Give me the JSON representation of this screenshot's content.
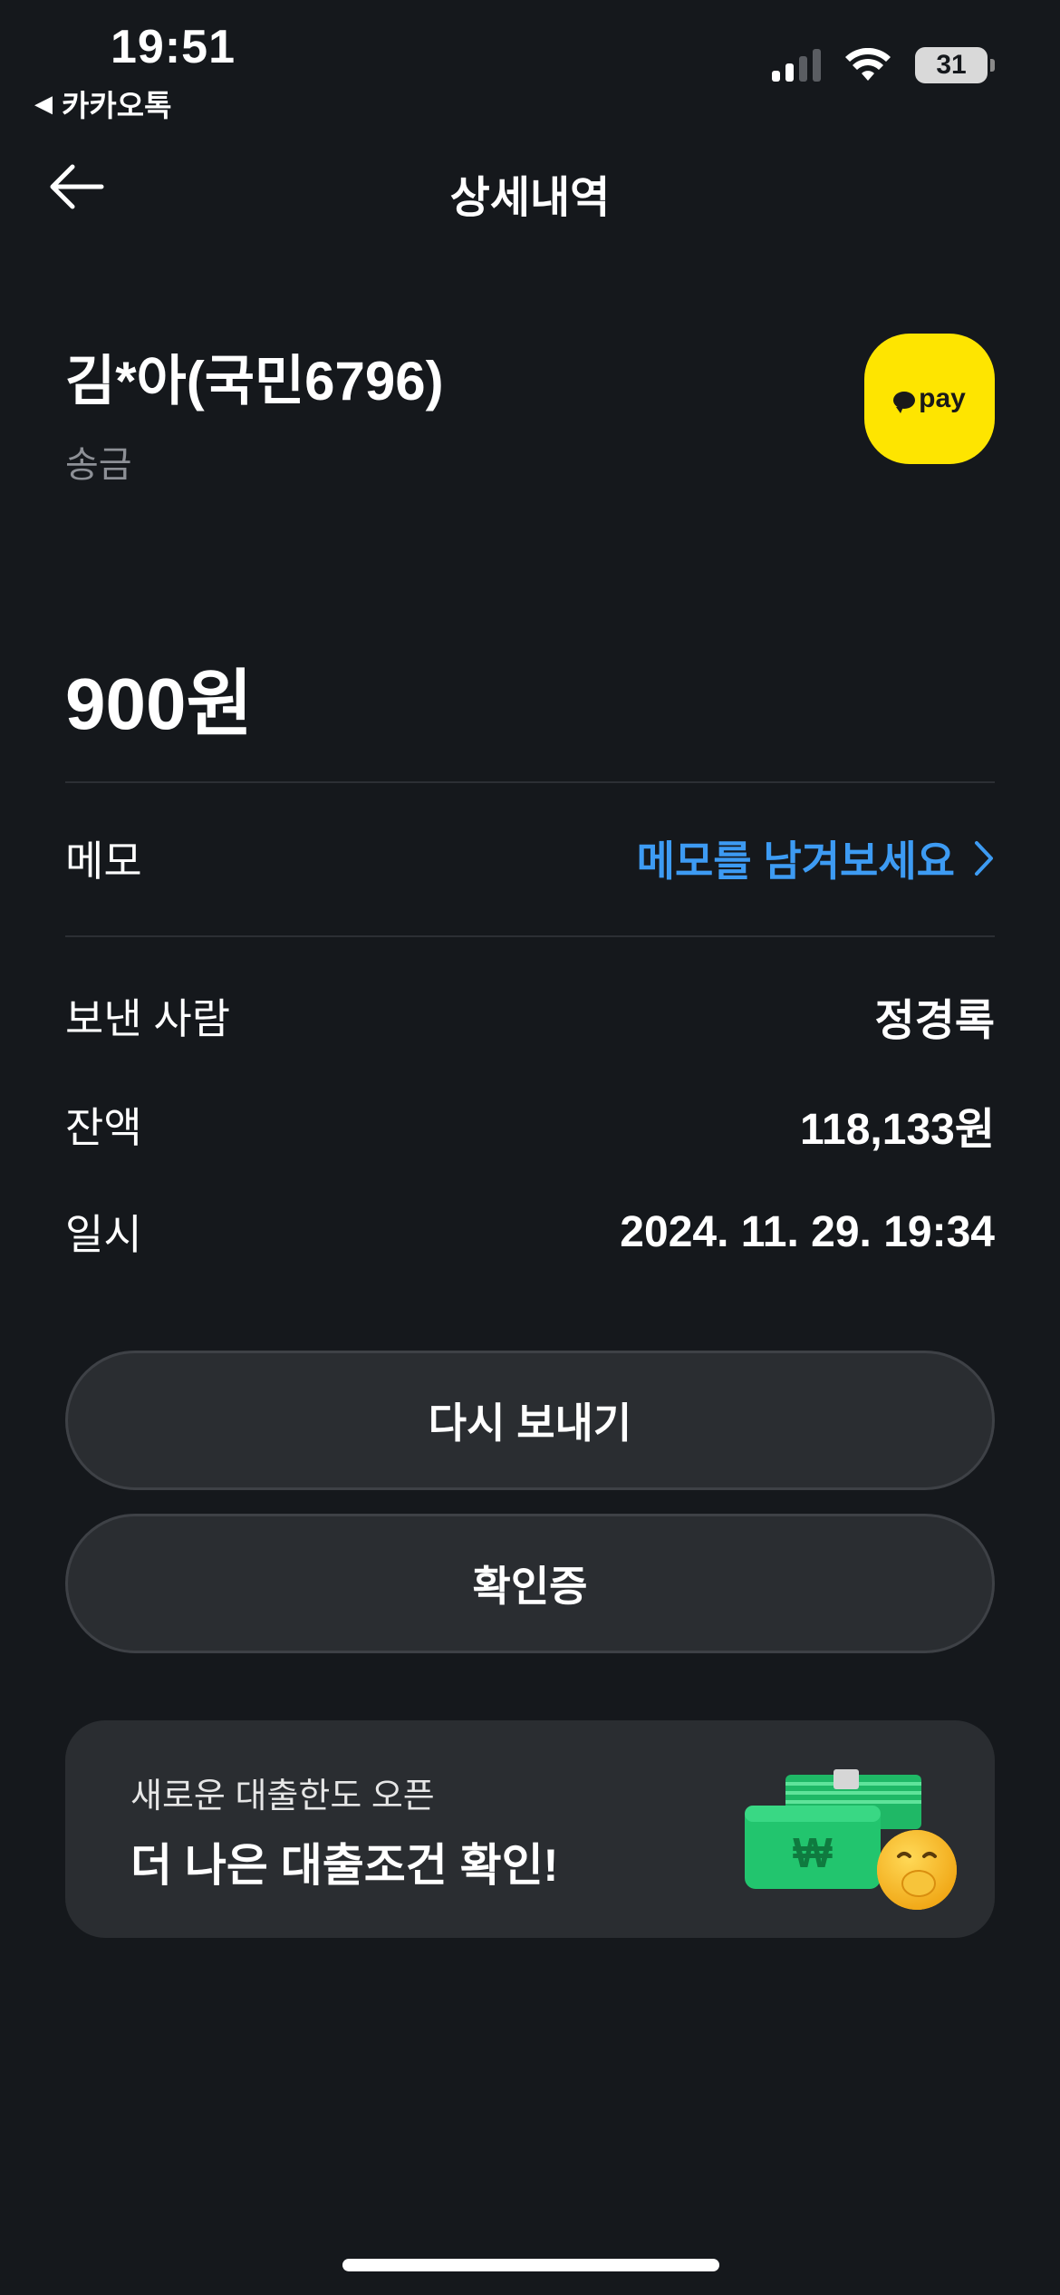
{
  "status_bar": {
    "time": "19:51",
    "back_app": "카카오톡",
    "battery": "31",
    "icons": [
      "signal-icon",
      "wifi-icon",
      "battery-icon"
    ]
  },
  "header": {
    "title": "상세내역",
    "back_icon": "arrow-left-icon"
  },
  "transaction": {
    "recipient": "김*아(국민6796)",
    "type": "송금",
    "badge_text": "pay",
    "amount": "900원"
  },
  "memo": {
    "label": "메모",
    "link": "메모를 남겨보세요"
  },
  "details": [
    {
      "label": "보낸 사람",
      "value": "정경록"
    },
    {
      "label": "잔액",
      "value": "118,133원"
    },
    {
      "label": "일시",
      "value": "2024. 11. 29. 19:34"
    }
  ],
  "buttons": {
    "resend": "다시 보내기",
    "receipt": "확인증"
  },
  "banner": {
    "subtitle": "새로운 대출한도 오픈",
    "title": "더 나은 대출조건 확인!"
  },
  "colors": {
    "background": "#15181c",
    "surface": "#2a2d31",
    "accent_link": "#3d9bf3",
    "kakao_yellow": "#fee500"
  }
}
